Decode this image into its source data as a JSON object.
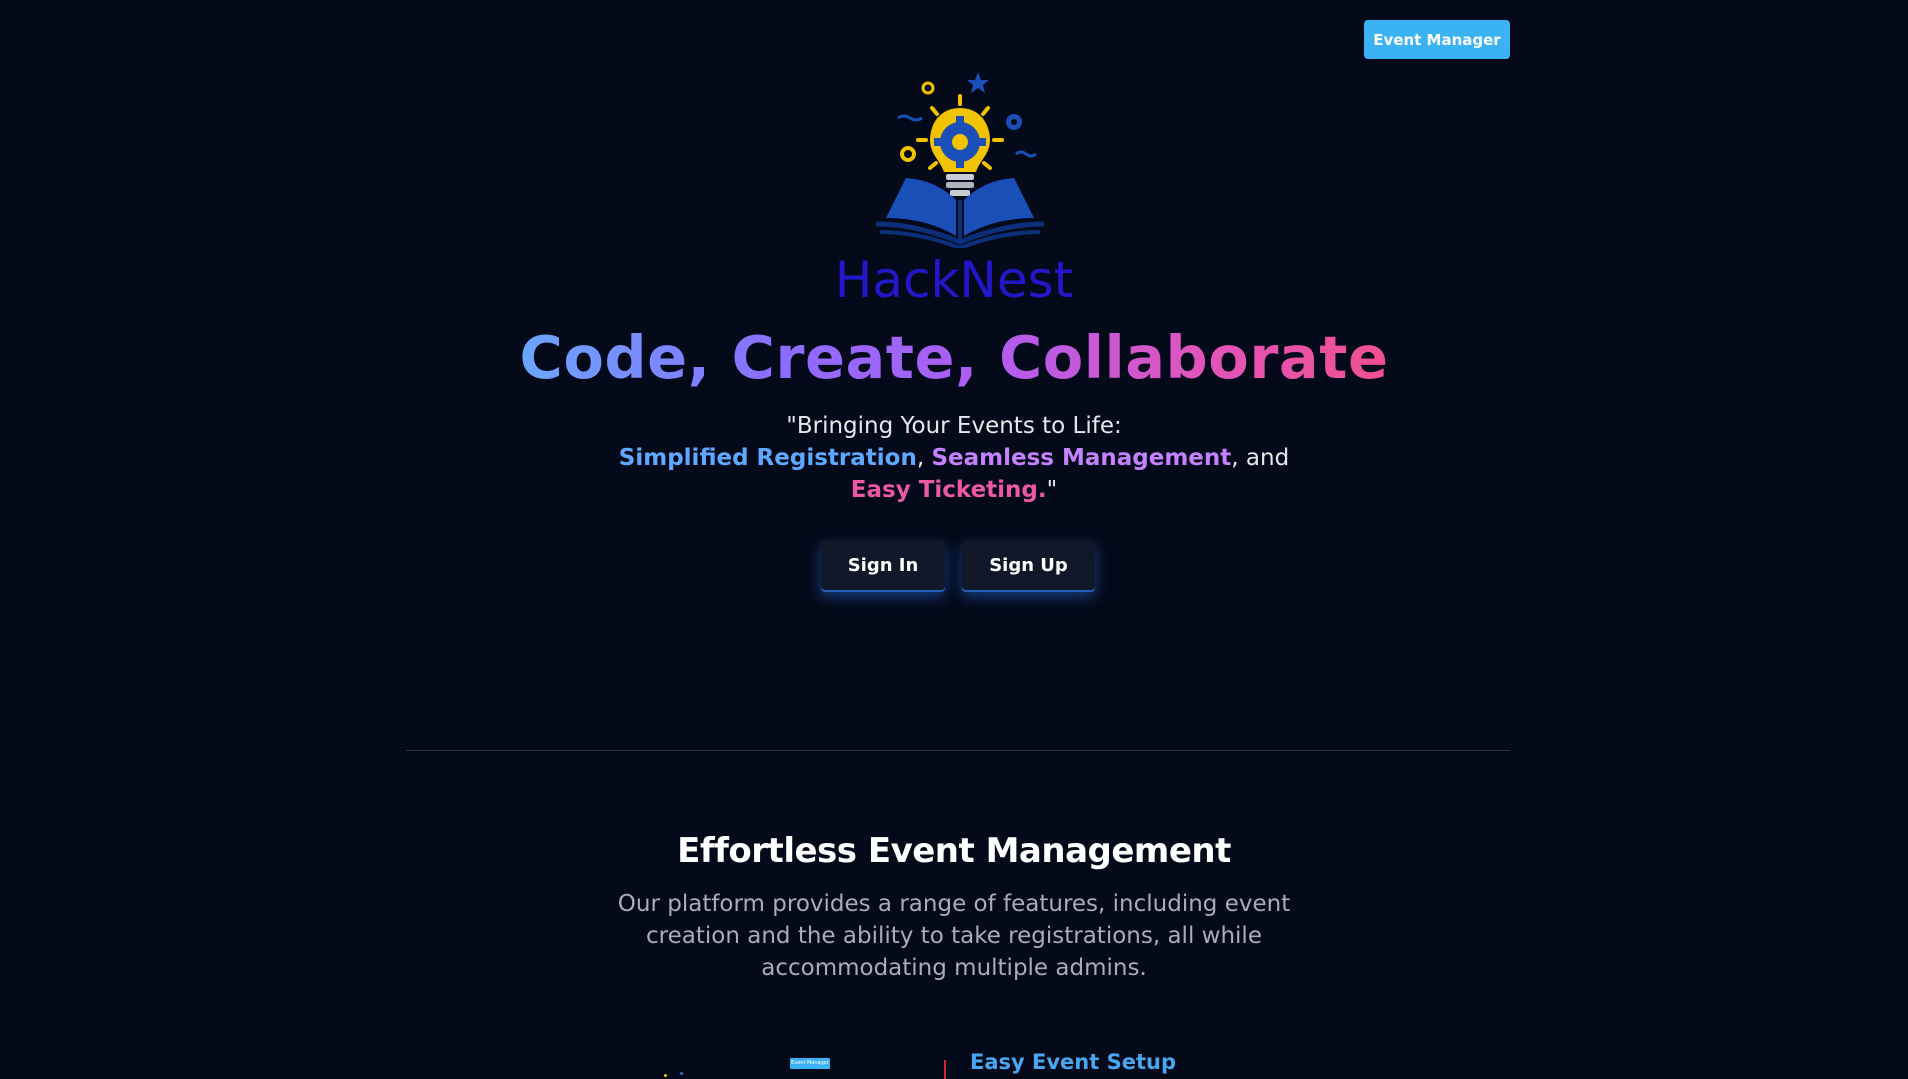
{
  "header": {
    "event_manager_label": "Event Manager"
  },
  "brand": {
    "name": "HackNest"
  },
  "hero": {
    "title": "Code, Create, Collaborate",
    "tagline_intro": "\"Bringing Your Events to Life:",
    "highlight_1": "Simplified Registration",
    "sep_1": ",",
    "highlight_2": "Seamless Management",
    "sep_2": ", and",
    "highlight_3": "Easy Ticketing.",
    "tagline_end": "\""
  },
  "auth": {
    "signin_label": "Sign In",
    "signup_label": "Sign Up"
  },
  "features": {
    "title": "Effortless Event Management",
    "description": "Our platform provides a range of features, including event creation and the ability to take registrations, all while accommodating multiple admins.",
    "preview_badge": "Event Manager",
    "first_feature_title": "Easy Event Setup"
  },
  "colors": {
    "background": "#050a1a",
    "accent": "#3bb3f3",
    "brand": "#2218c9",
    "highlight_blue": "#5fa8ff",
    "highlight_purple": "#c482ff",
    "highlight_pink": "#ec5aa0"
  },
  "icons": {
    "logo": "lightbulb-book-logo"
  }
}
